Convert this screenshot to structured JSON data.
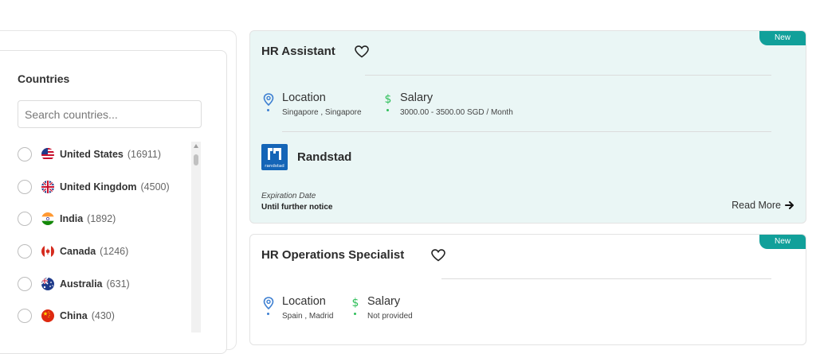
{
  "sidebar": {
    "title": "Countries",
    "search_placeholder": "Search countries...",
    "countries": [
      {
        "name": "United States",
        "count": "(16911)",
        "flag": "us-flag-icon"
      },
      {
        "name": "United Kingdom",
        "count": "(4500)",
        "flag": "uk-flag-icon"
      },
      {
        "name": "India",
        "count": "(1892)",
        "flag": "india-flag-icon"
      },
      {
        "name": "Canada",
        "count": "(1246)",
        "flag": "canada-flag-icon"
      },
      {
        "name": "Australia",
        "count": "(631)",
        "flag": "australia-flag-icon"
      },
      {
        "name": "China",
        "count": "(430)",
        "flag": "china-flag-icon"
      }
    ]
  },
  "jobs": [
    {
      "badge": "New",
      "title": "HR Assistant",
      "location_label": "Location",
      "location": "Singapore , Singapore",
      "salary_label": "Salary",
      "salary": "3000.00 - 3500.00 SGD / Month",
      "company": "Randstad",
      "company_logo_text": "randstad",
      "expiration_label": "Expiration Date",
      "expiration": "Until further notice",
      "read_more": "Read More"
    },
    {
      "badge": "New",
      "title": "HR Operations Specialist",
      "location_label": "Location",
      "location": "Spain , Madrid",
      "salary_label": "Salary",
      "salary": "Not provided"
    }
  ],
  "colors": {
    "accent": "#11a09a",
    "card_highlight": "#eaf6f5",
    "location_icon": "#3d7fd1",
    "salary_icon": "#2fbf5a",
    "company_logo": "#1565b7"
  }
}
